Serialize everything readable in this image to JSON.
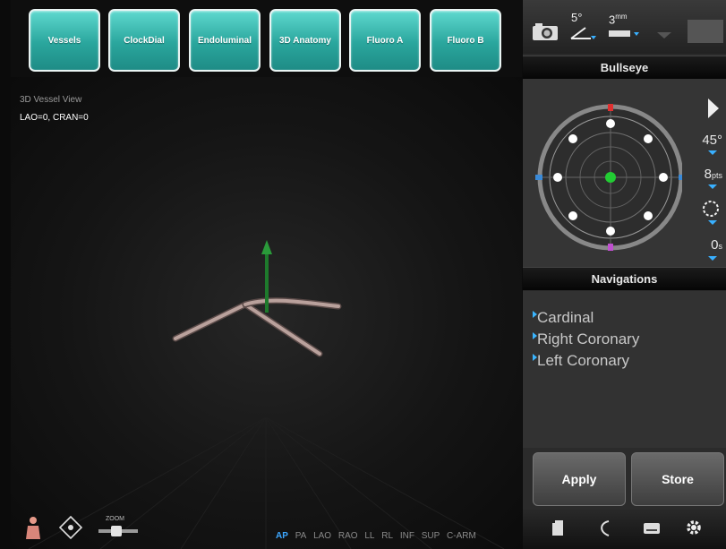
{
  "tabs": [
    {
      "label": "Vessels"
    },
    {
      "label": "ClockDial"
    },
    {
      "label": "Endoluminal"
    },
    {
      "label": "3D Anatomy"
    },
    {
      "label": "Fluoro A"
    },
    {
      "label": "Fluoro B"
    }
  ],
  "viewport": {
    "title": "3D Vessel View",
    "angle": "LAO=0, CRAN=0",
    "zoom_label": "ZOOM",
    "views": [
      "AP",
      "PA",
      "LAO",
      "RAO",
      "LL",
      "RL",
      "INF",
      "SUP",
      "C-ARM"
    ],
    "active_view": "AP"
  },
  "toolbar": {
    "angle_step": "5°",
    "size_value": "3",
    "size_unit": "mm",
    "camera_icon": "camera-icon"
  },
  "bullseye": {
    "title": "Bullseye",
    "angle": "45°",
    "points": "8",
    "points_unit": "pts",
    "time": "0",
    "time_unit": "s"
  },
  "navigations": {
    "title": "Navigations",
    "items": [
      {
        "label": "Cardinal"
      },
      {
        "label": "Right Coronary"
      },
      {
        "label": "Left Coronary"
      }
    ]
  },
  "actions": {
    "apply_label": "Apply",
    "store_label": "Store"
  },
  "colors": {
    "tab_teal": "#2aa69d",
    "accent_blue": "#3da7ff",
    "center_green": "#22cc33"
  }
}
